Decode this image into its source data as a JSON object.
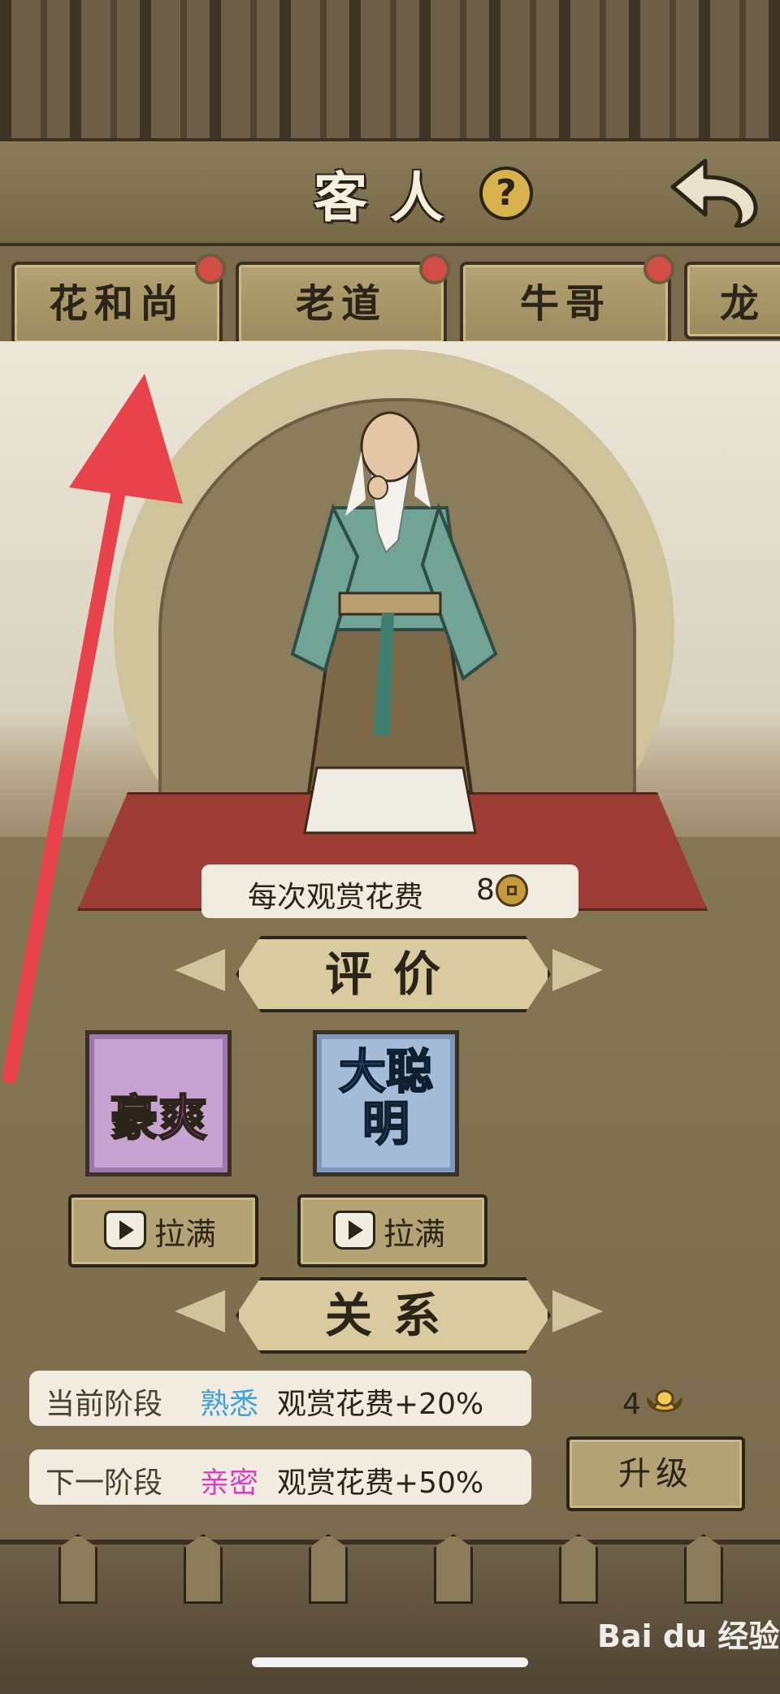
{
  "header": {
    "title": "客人",
    "help_icon": "question-icon",
    "back_icon": "back-arrow-icon"
  },
  "guests": [
    {
      "name": "花和尚",
      "has_notification": true
    },
    {
      "name": "老道",
      "has_notification": true
    },
    {
      "name": "牛哥",
      "has_notification": true
    },
    {
      "name": "龙",
      "has_notification": false
    }
  ],
  "cost": {
    "label": "每次观赏花费",
    "value": "8",
    "currency_icon": "coin-icon"
  },
  "evaluation": {
    "title": "评价"
  },
  "traits": [
    {
      "label": "豪爽",
      "color": "#c7a3d2",
      "button_label": "拉满"
    },
    {
      "label": "大聪明",
      "color": "#a5bcd9",
      "button_label": "拉满"
    }
  ],
  "relationship": {
    "title": "关系",
    "current": {
      "title": "当前阶段",
      "stage": "熟悉",
      "stage_color": "#3fa3d6",
      "effect": "观赏花费+20%"
    },
    "next": {
      "title": "下一阶段",
      "stage": "亲密",
      "stage_color": "#d63fc2",
      "effect": "观赏花费+50%"
    }
  },
  "upgrade": {
    "cost": "4",
    "currency_icon": "gold-ingot-icon",
    "label": "升级"
  },
  "watermark": "Bai du 经验",
  "annotation_color": "#e8434b"
}
